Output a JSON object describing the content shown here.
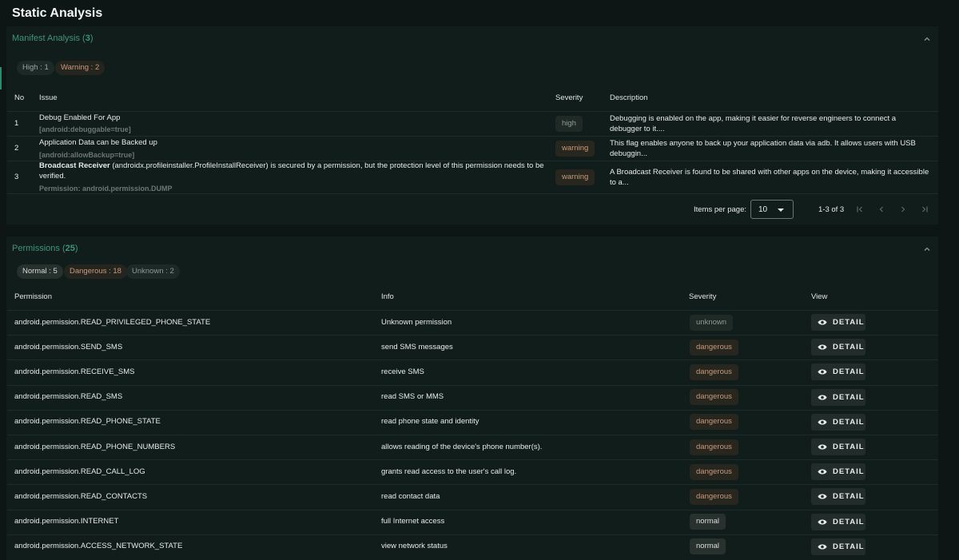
{
  "page": {
    "title": "Static Analysis"
  },
  "manifest": {
    "title": "Manifest Analysis",
    "count": "3",
    "chips": {
      "high": "High : 1",
      "warning": "Warning : 2"
    },
    "columns": {
      "no": "No",
      "issue": "Issue",
      "severity": "Severity",
      "description": "Description"
    },
    "rows": [
      {
        "no": "1",
        "issue_line1": "Debug Enabled For App",
        "issue_sub": "[android:debuggable=true]",
        "severity": "high",
        "desc_line1": "Debugging is enabled on the app, making it easier for reverse engineers to connect a",
        "desc_line2": "debugger to it...."
      },
      {
        "no": "2",
        "issue_line1": "Application Data can be Backed up",
        "issue_sub": "[android:allowBackup=true]",
        "severity": "warning",
        "desc_line1": "This flag enables anyone to back up your application data via adb. It allows users with USB",
        "desc_line2": "debuggin..."
      },
      {
        "no": "3",
        "issue_bold": "Broadcast Receiver",
        "issue_rest": " (androidx.profileinstaller.ProfileInstallReceiver) is secured by a permission, but the protection level of this permission needs to be",
        "issue_line2": "verified.",
        "issue_sub_label": "Permission:",
        "issue_sub_value": " android.permission.DUMP",
        "severity": "warning",
        "desc_line1": "A Broadcast Receiver is found to be shared with other apps on the device, making it accessible",
        "desc_line2": "to a..."
      }
    ],
    "pagination": {
      "items_per_page_label": "Items per page:",
      "items_per_page_value": "10",
      "range": "1-3 of 3"
    }
  },
  "permissions": {
    "title": "Permissions",
    "count": "25",
    "chips": {
      "normal": "Normal : 5",
      "dangerous": "Dangerous : 18",
      "unknown": "Unknown : 2"
    },
    "columns": {
      "permission": "Permission",
      "info": "Info",
      "severity": "Severity",
      "view": "View"
    },
    "detail_label": "DETAIL",
    "rows": [
      {
        "permission": "android.permission.READ_PRIVILEGED_PHONE_STATE",
        "info": "Unknown permission",
        "severity": "unknown"
      },
      {
        "permission": "android.permission.SEND_SMS",
        "info": "send SMS messages",
        "severity": "dangerous"
      },
      {
        "permission": "android.permission.RECEIVE_SMS",
        "info": "receive SMS",
        "severity": "dangerous"
      },
      {
        "permission": "android.permission.READ_SMS",
        "info": "read SMS or MMS",
        "severity": "dangerous"
      },
      {
        "permission": "android.permission.READ_PHONE_STATE",
        "info": "read phone state and identity",
        "severity": "dangerous"
      },
      {
        "permission": "android.permission.READ_PHONE_NUMBERS",
        "info": "allows reading of the device's phone number(s).",
        "severity": "dangerous"
      },
      {
        "permission": "android.permission.READ_CALL_LOG",
        "info": "grants read access to the user's call log.",
        "severity": "dangerous"
      },
      {
        "permission": "android.permission.READ_CONTACTS",
        "info": "read contact data",
        "severity": "dangerous"
      },
      {
        "permission": "android.permission.INTERNET",
        "info": "full Internet access",
        "severity": "normal"
      },
      {
        "permission": "android.permission.ACCESS_NETWORK_STATE",
        "info": "view network status",
        "severity": "normal"
      }
    ]
  }
}
